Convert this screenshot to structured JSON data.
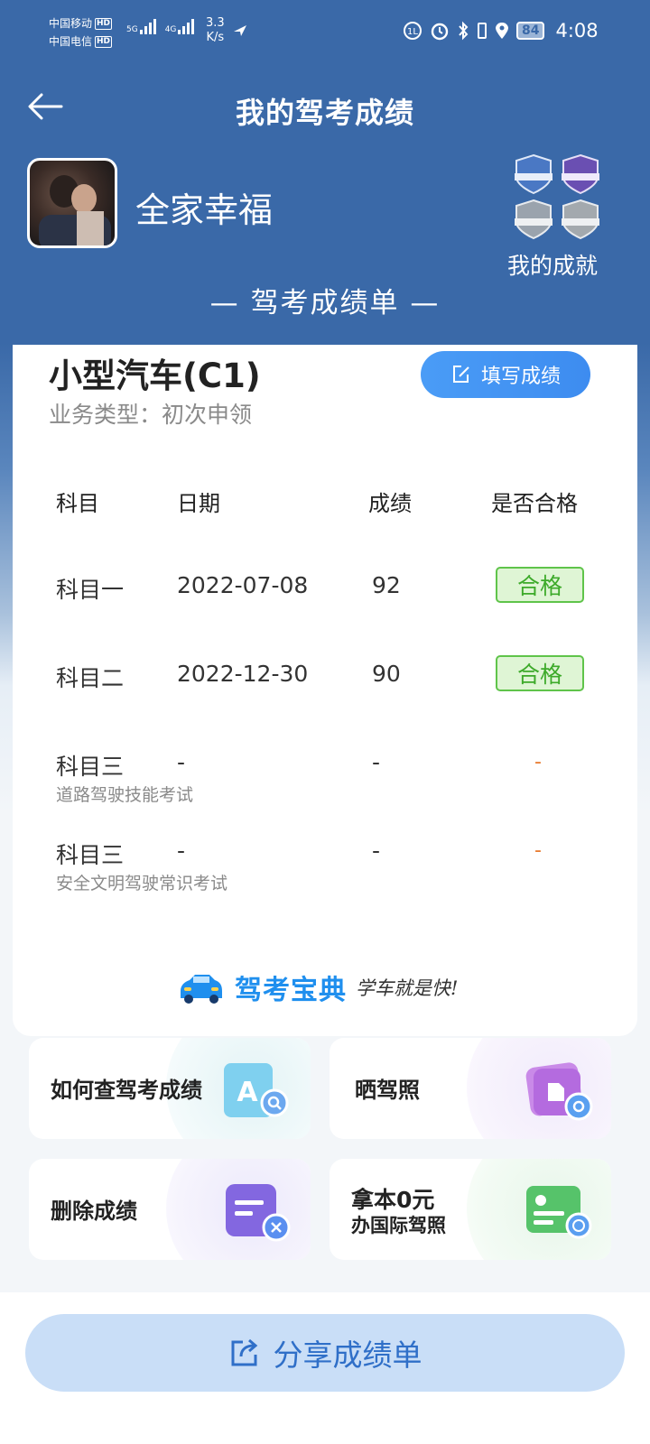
{
  "status_bar": {
    "carrier1": "中国移动",
    "carrier2": "中国电信",
    "hd": "HD",
    "net1": "5G",
    "net2": "4G",
    "speed_value": "3.3",
    "speed_unit": "K/s",
    "battery": "84",
    "time": "4:08"
  },
  "header": {
    "title": "我的驾考成绩",
    "user_name": "全家幸福",
    "achievements_label": "我的成就",
    "sheet_title": "— 驾考成绩单 —"
  },
  "license": {
    "vehicle_type": "小型汽车(C1)",
    "business_type": "业务类型：初次申领",
    "fill_button": "填写成绩"
  },
  "table": {
    "headers": [
      "科目",
      "日期",
      "成绩",
      "是否合格"
    ],
    "rows": [
      {
        "subject": "科目一",
        "sub": "",
        "date": "2022-07-08",
        "score": "92",
        "result": "合格"
      },
      {
        "subject": "科目二",
        "sub": "",
        "date": "2022-12-30",
        "score": "90",
        "result": "合格"
      },
      {
        "subject": "科目三",
        "sub": "道路驾驶技能考试",
        "date": "-",
        "score": "-",
        "result": "-"
      },
      {
        "subject": "科目三",
        "sub": "安全文明驾驶常识考试",
        "date": "-",
        "score": "-",
        "result": "-"
      }
    ]
  },
  "brand": {
    "logo": "驾考宝典",
    "slogan": "学车就是快!"
  },
  "tiles": [
    {
      "label": "如何查驾考成绩",
      "icon": "search-doc-icon"
    },
    {
      "label": "晒驾照",
      "icon": "photo-share-icon"
    },
    {
      "label": "删除成绩",
      "icon": "delete-doc-icon"
    },
    {
      "label_line1": "拿本0元",
      "label_line2": "办国际驾照",
      "icon": "intl-license-icon"
    }
  ],
  "share_button": "分享成绩单",
  "colors": {
    "header_blue": "#3a69a8",
    "pass_green": "#3daa2a",
    "accent_blue": "#3d8cf0",
    "dash_orange": "#e87a2e"
  }
}
